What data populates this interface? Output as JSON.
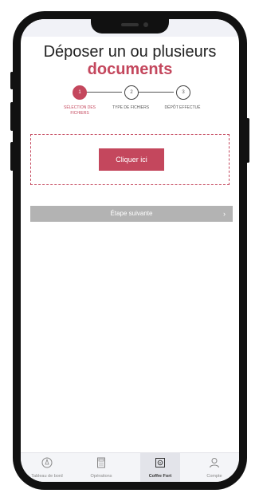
{
  "title": {
    "line1": "Déposer un ou plusieurs",
    "line2": "documents"
  },
  "stepper": {
    "steps": [
      {
        "number": "1",
        "label": "SÉLECTION DES FICHIERS",
        "active": true
      },
      {
        "number": "2",
        "label": "TYPE DE FICHIERS",
        "active": false
      },
      {
        "number": "3",
        "label": "DÉPÔT EFFECTUÉ",
        "active": false
      }
    ]
  },
  "dropzone": {
    "button_label": "Cliquer ici"
  },
  "next": {
    "label": "Étape suivante",
    "chevron": "›"
  },
  "tabbar": {
    "items": [
      {
        "label": "Tableau de bord",
        "icon": "dashboard-icon"
      },
      {
        "label": "Opérations",
        "icon": "calculator-icon"
      },
      {
        "label": "Coffre Fort",
        "icon": "safe-icon",
        "active": true
      },
      {
        "label": "Compte",
        "icon": "user-icon"
      }
    ]
  },
  "colors": {
    "accent": "#c4475d",
    "disabled": "#b3b3b3"
  }
}
